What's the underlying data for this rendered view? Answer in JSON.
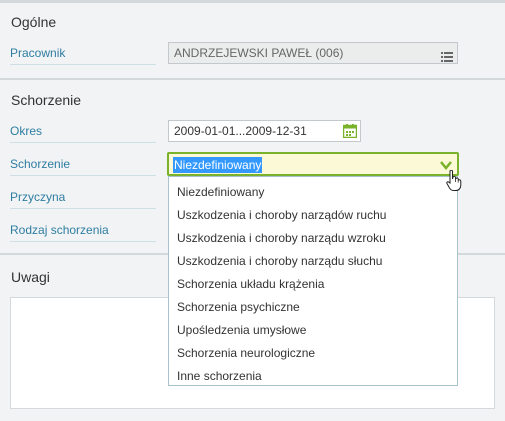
{
  "general": {
    "title": "Ogólne",
    "employee_label": "Pracownik",
    "employee_value": "ANDRZEJEWSKI PAWEŁ (006)"
  },
  "illness": {
    "title": "Schorzenie",
    "period_label": "Okres",
    "period_value": "2009-01-01...2009-12-31",
    "illness_label": "Schorzenie",
    "illness_value": "Niezdefiniowany",
    "cause_label": "Przyczyna",
    "type_label": "Rodzaj schorzenia"
  },
  "dropdown": {
    "options": [
      "Niezdefiniowany",
      "Uszkodzenia i choroby narządów ruchu",
      "Uszkodzenia i choroby narządu wzroku",
      "Uszkodzenia i choroby narządu słuchu",
      "Schorzenia układu krążenia",
      "Schorzenia psychiczne",
      "Upośledzenia umysłowe",
      "Schorzenia neurologiczne",
      "Inne schorzenia"
    ]
  },
  "notes": {
    "title": "Uwagi"
  },
  "colors": {
    "label": "#2e7ea2",
    "accent": "#7ab22b",
    "selection": "#3399ff",
    "active_field": "#fbf9d6"
  },
  "icons": {
    "employee_picker": "list-icon",
    "period_picker": "calendar-icon",
    "illness_dropdown": "chevron-down-icon",
    "pointer": "hand-cursor-icon"
  }
}
